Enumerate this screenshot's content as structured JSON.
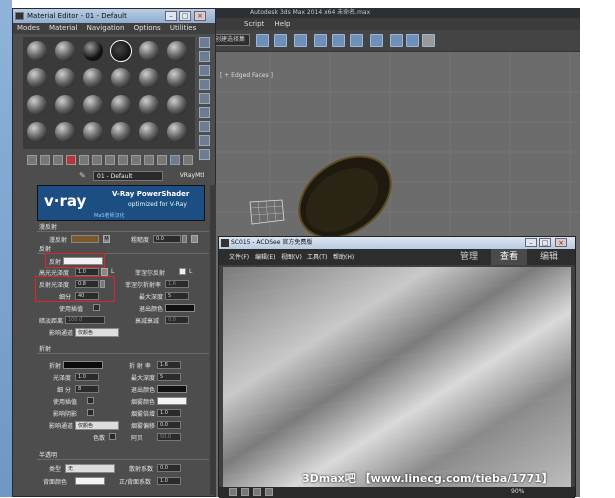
{
  "max": {
    "title": "Autodesk 3ds Max  2014 x64     未命名.max",
    "menu": [
      "Script",
      "Help"
    ],
    "toolbar_dropdown": "创建选择集",
    "viewport_label": "[ + Edged Faces ]"
  },
  "material_editor": {
    "title": "Material Editor - 01 - Default",
    "menu": [
      "Modes",
      "Material",
      "Navigation",
      "Options",
      "Utilities"
    ],
    "slot_name": "01 - Default",
    "slot_type": "VRayMtl",
    "vray_logo": "v·ray",
    "vray_title": "V-Ray PowerShader",
    "vray_subtitle": "optimized for V-Ray",
    "vray_watermark": "MaS老师汉化",
    "diffuse": {
      "header": "漫反射",
      "label": "漫反射",
      "map": "M",
      "roughness_label": "粗糙度",
      "roughness": "0.0",
      "swatch": "#7a5a2a"
    },
    "reflection": {
      "header": "反射",
      "label": "反射",
      "swatch": "#f2f2f2",
      "hilight_label": "高光光泽度",
      "hilight": "1.0",
      "hilight_lock": "L",
      "fresnel_label": "菲涅尔反射",
      "gloss_label": "反射光泽度",
      "gloss": "0.8",
      "fresnel_ior_label": "菲涅尔折射率",
      "fresnel_ior": "1.6",
      "subdivs_label": "细分",
      "subdivs": "40",
      "max_depth_label": "最大深度",
      "max_depth": "5",
      "interp_label": "使用插值",
      "exit_color_label": "退出颜色",
      "dim_dist_label": "暗淡距离",
      "dim_dist": "100.0",
      "dim_falloff_label": "衰减衰减",
      "dim_falloff": "0.0",
      "affect_label": "影响通道",
      "affect": "仅颜色"
    },
    "refraction": {
      "header": "折射",
      "label": "折射",
      "ior_label": "折 射 率",
      "ior": "1.6",
      "gloss_label": "光泽度",
      "gloss": "1.0",
      "max_depth_label": "最大深度",
      "max_depth": "5",
      "subdivs_label": "细 分",
      "subdivs": "8",
      "exit_color_label": "退出颜色",
      "interp_label": "使用插值",
      "fog_color_label": "烟雾颜色",
      "shadows_label": "影响阴影",
      "fog_mult_label": "烟雾倍增",
      "fog_mult": "1.0",
      "affect_label": "影响通道",
      "affect": "仅颜色",
      "fog_bias_label": "烟雾偏移",
      "fog_bias": "0.0",
      "dispersion_label": "色散",
      "abbe_label": "阿贝",
      "abbe": "50.0"
    },
    "translucency": {
      "header": "半透明",
      "type_label": "类型",
      "type": "无",
      "scatter_label": "散射系数",
      "scatter": "0.0",
      "back_color_label": "背面颜色",
      "fwd_label": "正/背面系数",
      "fwd": "1.0"
    }
  },
  "acdsee": {
    "title": "SC015 - ACDSee 官方免费版",
    "menu": [
      "文件(F)",
      "编辑(E)",
      "视图(V)",
      "工具(T)",
      "帮助(H)"
    ],
    "tabs": [
      "管理",
      "查看",
      "编辑"
    ],
    "zoom": "90%"
  },
  "footer": "3Dmax吧 【www.linecg.com/tieba/1771】"
}
